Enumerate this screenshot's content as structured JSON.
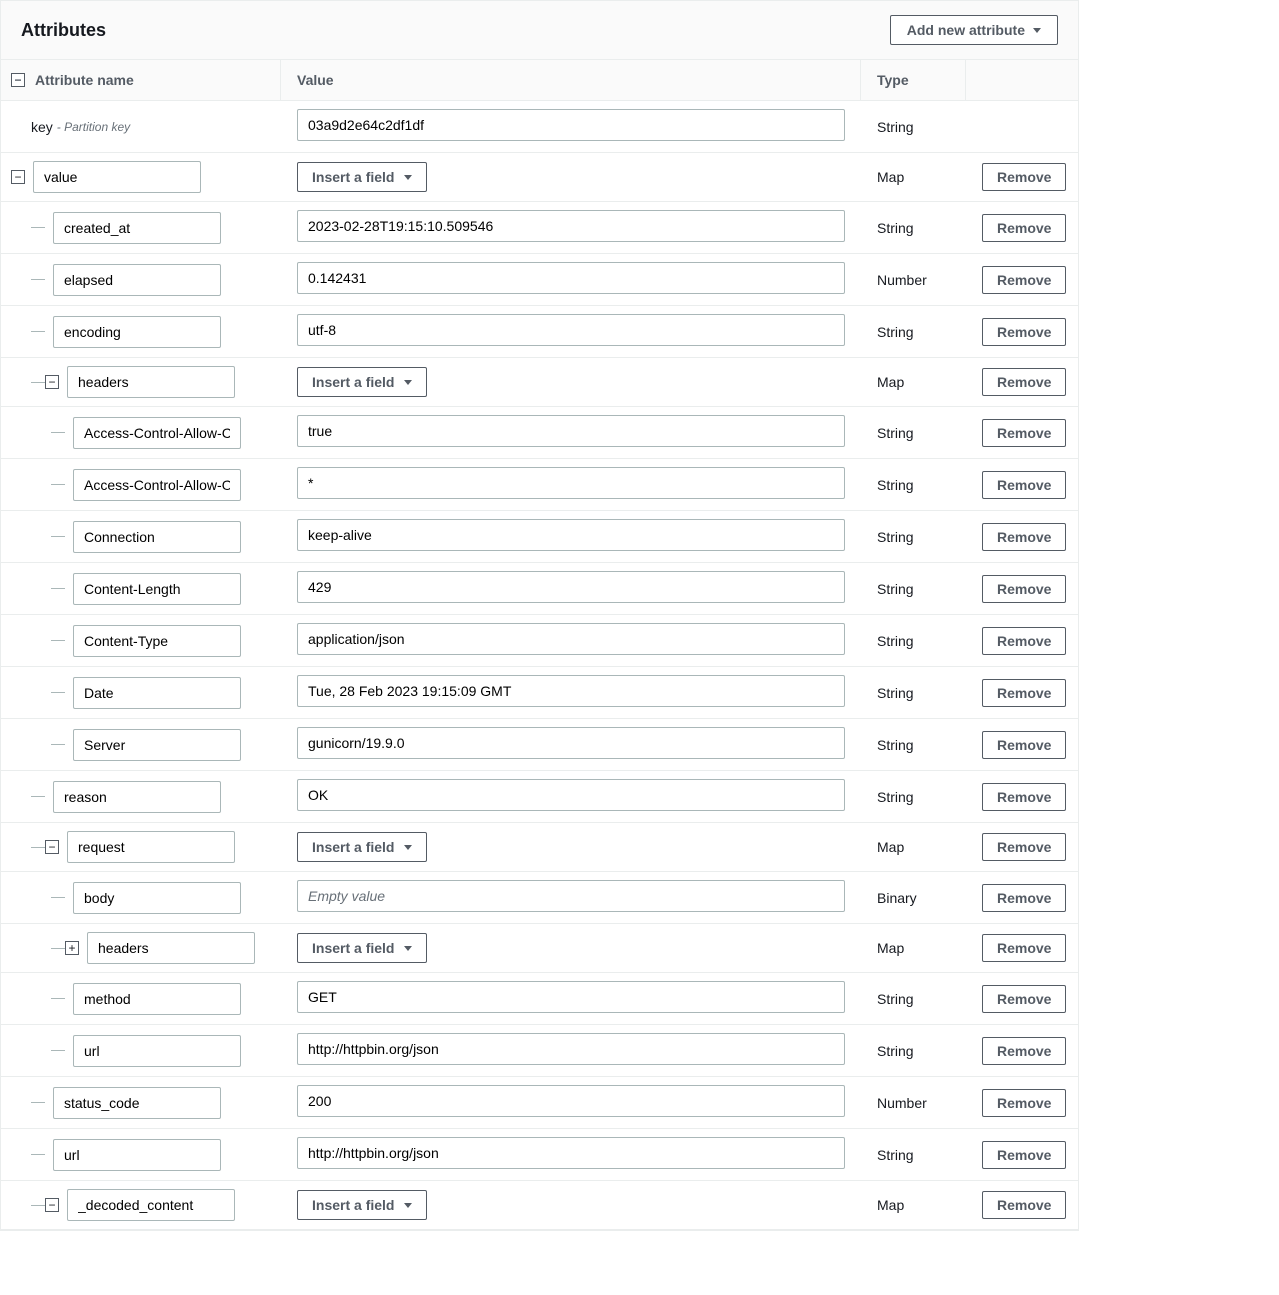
{
  "labels": {
    "panel_title": "Attributes",
    "add_new": "Add new attribute",
    "col_name": "Attribute name",
    "col_value": "Value",
    "col_type": "Type",
    "insert_field": "Insert a field",
    "remove": "Remove",
    "partition_key": "- Partition key",
    "empty_value": "Empty value"
  },
  "types": {
    "string": "String",
    "number": "Number",
    "map": "Map",
    "binary": "Binary"
  },
  "rows": [
    {
      "depth": 0,
      "toggle": null,
      "static_name": "key",
      "partition": true,
      "value_kind": "text",
      "value": "03a9d2e64c2df1df",
      "type": "string",
      "removable": false
    },
    {
      "depth": 0,
      "toggle": "minus",
      "name": "value",
      "value_kind": "insert",
      "type": "map",
      "removable": true
    },
    {
      "depth": 1,
      "toggle": null,
      "name": "created_at",
      "value_kind": "text",
      "value": "2023-02-28T19:15:10.509546",
      "type": "string",
      "removable": true
    },
    {
      "depth": 1,
      "toggle": null,
      "name": "elapsed",
      "value_kind": "text",
      "value": "0.142431",
      "type": "number",
      "removable": true
    },
    {
      "depth": 1,
      "toggle": null,
      "name": "encoding",
      "value_kind": "text",
      "value": "utf-8",
      "type": "string",
      "removable": true
    },
    {
      "depth": 1,
      "toggle": "minus",
      "name": "headers",
      "value_kind": "insert",
      "type": "map",
      "removable": true
    },
    {
      "depth": 2,
      "toggle": null,
      "name": "Access-Control-Allow-Creder",
      "value_kind": "text",
      "value": "true",
      "type": "string",
      "removable": true
    },
    {
      "depth": 2,
      "toggle": null,
      "name": "Access-Control-Allow-Origin",
      "value_kind": "text",
      "value": "*",
      "type": "string",
      "removable": true
    },
    {
      "depth": 2,
      "toggle": null,
      "name": "Connection",
      "value_kind": "text",
      "value": "keep-alive",
      "type": "string",
      "removable": true
    },
    {
      "depth": 2,
      "toggle": null,
      "name": "Content-Length",
      "value_kind": "text",
      "value": "429",
      "type": "string",
      "removable": true
    },
    {
      "depth": 2,
      "toggle": null,
      "name": "Content-Type",
      "value_kind": "text",
      "value": "application/json",
      "type": "string",
      "removable": true
    },
    {
      "depth": 2,
      "toggle": null,
      "name": "Date",
      "value_kind": "text",
      "value": "Tue, 28 Feb 2023 19:15:09 GMT",
      "type": "string",
      "removable": true
    },
    {
      "depth": 2,
      "toggle": null,
      "name": "Server",
      "value_kind": "text",
      "value": "gunicorn/19.9.0",
      "type": "string",
      "removable": true,
      "last_in_group": true
    },
    {
      "depth": 1,
      "toggle": null,
      "name": "reason",
      "value_kind": "text",
      "value": "OK",
      "type": "string",
      "removable": true
    },
    {
      "depth": 1,
      "toggle": "minus",
      "name": "request",
      "value_kind": "insert",
      "type": "map",
      "removable": true
    },
    {
      "depth": 2,
      "toggle": null,
      "name": "body",
      "value_kind": "placeholder",
      "value": "",
      "type": "binary",
      "removable": true
    },
    {
      "depth": 2,
      "toggle": "plus",
      "name": "headers",
      "value_kind": "insert",
      "type": "map",
      "removable": true
    },
    {
      "depth": 2,
      "toggle": null,
      "name": "method",
      "value_kind": "text",
      "value": "GET",
      "type": "string",
      "removable": true
    },
    {
      "depth": 2,
      "toggle": null,
      "name": "url",
      "value_kind": "text",
      "value": "http://httpbin.org/json",
      "type": "string",
      "removable": true,
      "last_in_group": true
    },
    {
      "depth": 1,
      "toggle": null,
      "name": "status_code",
      "value_kind": "text",
      "value": "200",
      "type": "number",
      "removable": true
    },
    {
      "depth": 1,
      "toggle": null,
      "name": "url",
      "value_kind": "text",
      "value": "http://httpbin.org/json",
      "type": "string",
      "removable": true
    },
    {
      "depth": 1,
      "toggle": "minus",
      "name": "_decoded_content",
      "value_kind": "insert",
      "type": "map",
      "removable": true
    }
  ]
}
